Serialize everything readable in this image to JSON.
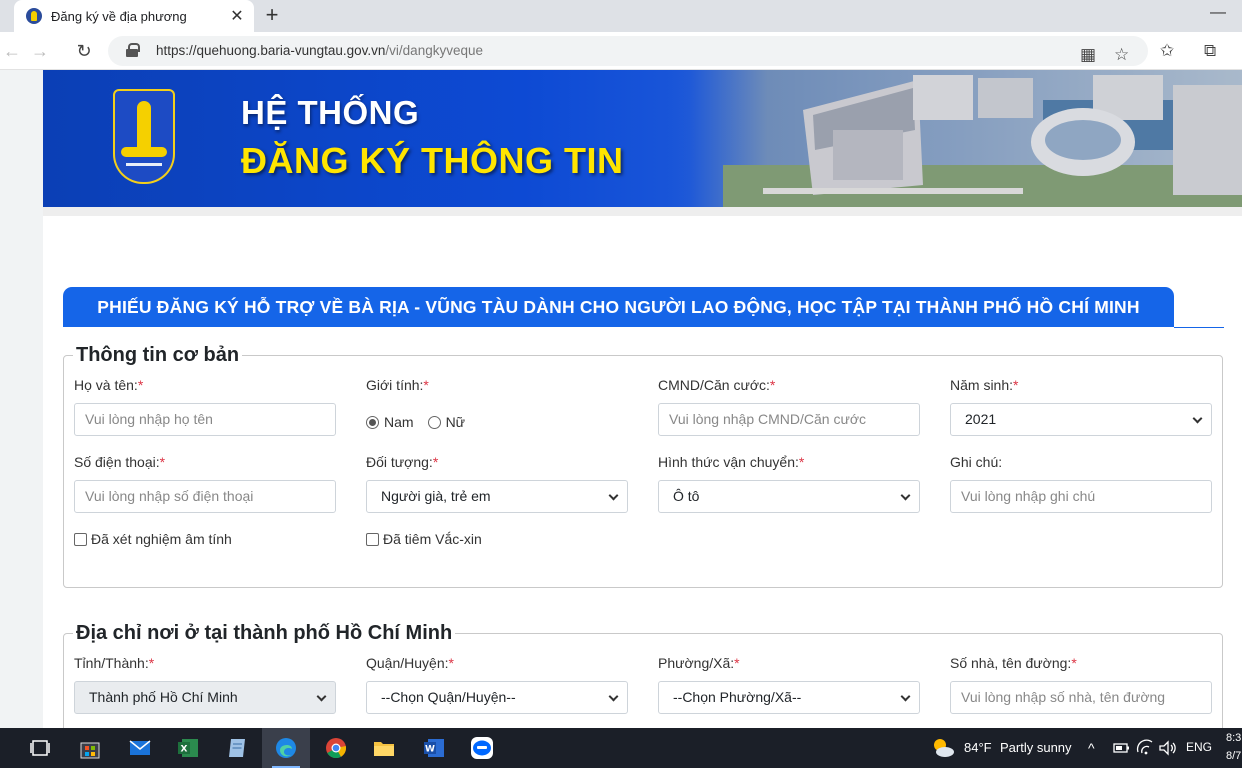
{
  "browser": {
    "tab_title": "Đăng ký về địa phương",
    "tab_close": "✕",
    "new_tab": "+",
    "window_minimize": "—",
    "url_host": "https://quehuong.baria-vungtau.gov.vn",
    "url_path": "/vi/dangkyveque"
  },
  "banner": {
    "line1": "HỆ THỐNG",
    "line2": "ĐĂNG KÝ THÔNG TIN"
  },
  "form": {
    "title": "PHIẾU ĐĂNG KÝ HỖ TRỢ VỀ BÀ RỊA - VŨNG TÀU DÀNH CHO NGƯỜI LAO ĐỘNG, HỌC TẬP TẠI THÀNH PHỐ HỒ CHÍ MINH",
    "required_mark": "*",
    "basic": {
      "legend": "Thông tin cơ bản",
      "name_label": "Họ và tên:",
      "name_placeholder": "Vui lòng nhập họ tên",
      "gender_label": "Giới tính:",
      "gender_male": "Nam",
      "gender_female": "Nữ",
      "gender_selected": "Nam",
      "id_label": "CMND/Căn cước:",
      "id_placeholder": "Vui lòng nhập CMND/Căn cước",
      "birth_label": "Năm sinh:",
      "birth_value": "2021",
      "phone_label": "Số điện thoại:",
      "phone_placeholder": "Vui lòng nhập số điện thoại",
      "subject_label": "Đối tượng:",
      "subject_value": "Người già, trẻ em",
      "transport_label": "Hình thức vận chuyển:",
      "transport_value": "Ô tô",
      "note_label": "Ghi chú:",
      "note_placeholder": "Vui lòng nhập ghi chú",
      "tested_label": "Đã xét nghiệm âm tính",
      "vaccinated_label": "Đã tiêm Vắc-xin"
    },
    "address": {
      "legend": "Địa chỉ nơi ở tại thành phố Hồ Chí Minh",
      "province_label": "Tỉnh/Thành:",
      "province_value": "Thành phố Hồ Chí Minh",
      "district_label": "Quận/Huyện:",
      "district_value": "--Chọn Quận/Huyện--",
      "ward_label": "Phường/Xã:",
      "ward_value": "--Chọn Phường/Xã--",
      "street_label": "Số nhà, tên đường:",
      "street_placeholder": "Vui lòng nhập số nhà, tên đường"
    }
  },
  "taskbar": {
    "weather_temp": "84°F",
    "weather_text": "Partly sunny",
    "language": "ENG",
    "clock_time": "8:3",
    "clock_date": "8/7"
  },
  "colors": {
    "brand_blue": "#1565e8",
    "banner_yellow": "#ffe500",
    "required_red": "#dc3545"
  }
}
